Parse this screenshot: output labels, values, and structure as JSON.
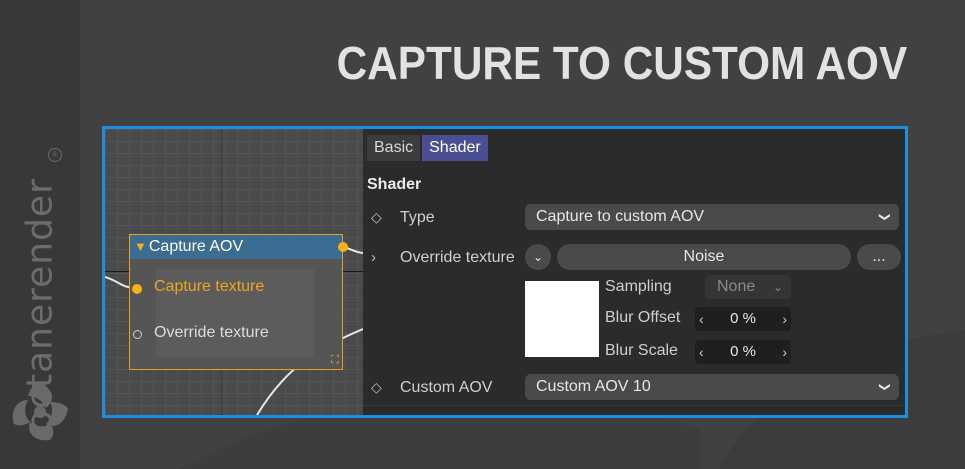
{
  "title": "CAPTURE TO CUSTOM AOV",
  "brand": {
    "name": "octanerender",
    "reg_mark": "®"
  },
  "colors": {
    "frame_border": "#1e8fe0",
    "node_accent": "#f5b212",
    "active_tab": "#4b4e93"
  },
  "node": {
    "title": "Capture AOV",
    "inputs": [
      {
        "label": "Capture texture",
        "connected": true
      },
      {
        "label": "Override texture",
        "connected": false
      }
    ]
  },
  "panel": {
    "tabs": [
      {
        "label": "Basic",
        "active": false
      },
      {
        "label": "Shader",
        "active": true
      }
    ],
    "section_title": "Shader",
    "type": {
      "label": "Type",
      "value": "Capture to custom AOV"
    },
    "override": {
      "label": "Override texture",
      "value": "Noise",
      "more_label": "..."
    },
    "sampling": {
      "label": "Sampling",
      "value": "None"
    },
    "blur_offset": {
      "label": "Blur Offset",
      "value": "0 %"
    },
    "blur_scale": {
      "label": "Blur Scale",
      "value": "0 %"
    },
    "custom_aov": {
      "label": "Custom AOV",
      "value": "Custom AOV 10"
    }
  }
}
